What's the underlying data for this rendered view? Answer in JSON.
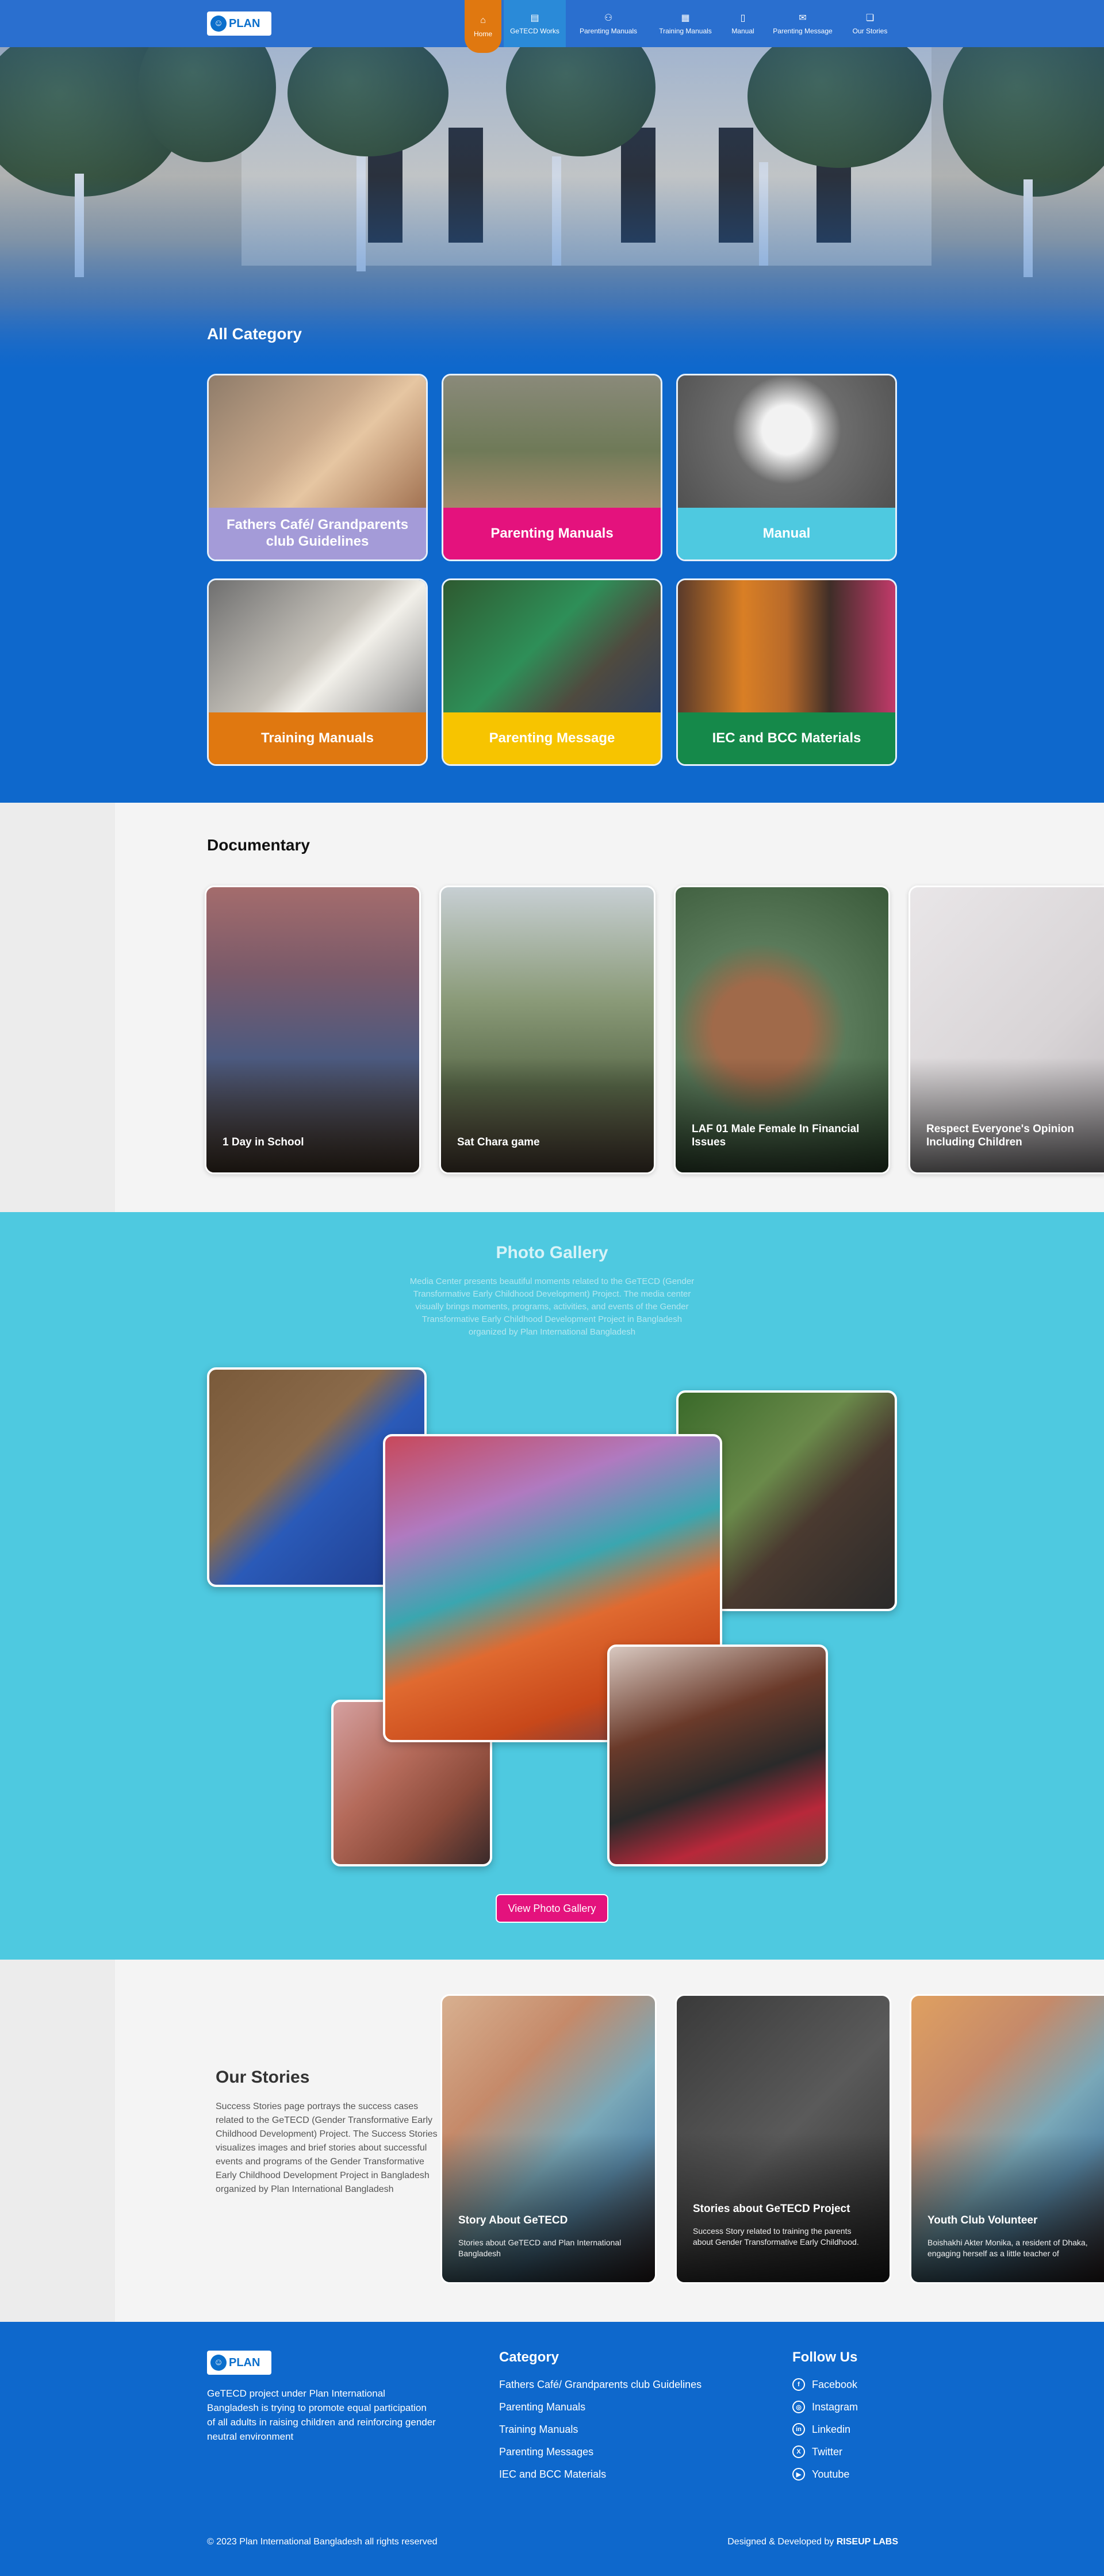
{
  "nav": {
    "items": [
      {
        "label": "Home",
        "icon": "home-icon"
      },
      {
        "label": "GeTECD Works",
        "icon": "document-icon"
      },
      {
        "label": "Parenting Manuals",
        "icon": "family-icon"
      },
      {
        "label": "Training Manuals",
        "icon": "training-icon"
      },
      {
        "label": "Manual",
        "icon": "manual-icon"
      },
      {
        "label": "Parenting Message",
        "icon": "message-icon"
      },
      {
        "label": "Our Stories",
        "icon": "stories-icon"
      }
    ]
  },
  "logo": {
    "text": "PLAN"
  },
  "categories": {
    "title": "All Category",
    "items": [
      {
        "label": "Fathers Café/ Grandparents club Guidelines",
        "color": "#a49bd8"
      },
      {
        "label": "Parenting Manuals",
        "color": "#e4127d"
      },
      {
        "label": "Manual",
        "color": "#4ec9e0"
      },
      {
        "label": "Training Manuals",
        "color": "#e07810"
      },
      {
        "label": "Parenting Message",
        "color": "#f7c400"
      },
      {
        "label": "IEC and BCC Materials",
        "color": "#15894a"
      }
    ]
  },
  "documentary": {
    "title": "Documentary",
    "items": [
      {
        "title": "1 Day in School"
      },
      {
        "title": "Sat Chara game"
      },
      {
        "title": "LAF 01 Male Female In Financial Issues"
      },
      {
        "title": "Respect Everyone's Opinion Including Children"
      }
    ]
  },
  "gallery": {
    "title": "Photo Gallery",
    "description": "Media Center presents beautiful moments related to the GeTECD (Gender Transformative Early Childhood Development) Project. The media center visually brings moments, programs, activities, and events of the Gender Transformative Early Childhood Development Project in Bangladesh organized by Plan International Bangladesh",
    "button": "View Photo Gallery"
  },
  "stories": {
    "title": "Our Stories",
    "description": "Success Stories page portrays the success cases related to the GeTECD (Gender Transformative Early Childhood Development) Project. The Success Stories visualizes images and brief stories about successful events and programs of the Gender Transformative Early Childhood Development Project in Bangladesh organized by Plan International Bangladesh",
    "items": [
      {
        "title": "Story About GeTECD",
        "desc": "Stories about GeTECD and Plan International Bangladesh"
      },
      {
        "title": "Stories about GeTECD Project",
        "desc": "Success Story related to training the parents about Gender Transformative Early Childhood."
      },
      {
        "title": "Youth Club Volunteer",
        "desc": "Boishakhi Akter Monika, a resident of Dhaka, engaging herself as a little teacher of"
      }
    ]
  },
  "footer": {
    "about": "GeTECD project under Plan International Bangladesh is trying to promote equal participation of all adults in raising children and reinforcing gender neutral environment",
    "category_title": "Category",
    "category_links": [
      "Fathers Café/ Grandparents club Guidelines",
      "Parenting Manuals",
      "Training Manuals",
      "Parenting Messages",
      "IEC and BCC Materials"
    ],
    "follow_title": "Follow Us",
    "social": [
      {
        "label": "Facebook",
        "icon": "facebook-icon",
        "glyph": "f"
      },
      {
        "label": "Instagram",
        "icon": "instagram-icon",
        "glyph": "◎"
      },
      {
        "label": "Linkedin",
        "icon": "linkedin-icon",
        "glyph": "in"
      },
      {
        "label": "Twitter",
        "icon": "twitter-icon",
        "glyph": "X"
      },
      {
        "label": "Youtube",
        "icon": "youtube-icon",
        "glyph": "▶"
      }
    ],
    "copyright": "© 2023 Plan International Bangladesh all rights reserved",
    "credit_prefix": "Designed & Developed by",
    "credit_name": "RISEUP LABS"
  }
}
